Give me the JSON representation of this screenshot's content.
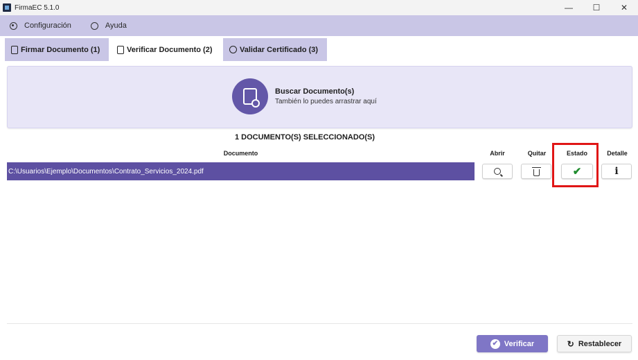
{
  "window": {
    "title": "FirmaEC 5.1.0",
    "controls": {
      "minimize": "—",
      "maximize": "☐",
      "close": "✕"
    }
  },
  "menu": {
    "items": [
      {
        "label": "Configuración",
        "icon": "gear-icon"
      },
      {
        "label": "Ayuda",
        "icon": "globe-icon"
      }
    ]
  },
  "tabs": [
    {
      "label": "Firmar Documento (1)",
      "active": false
    },
    {
      "label": "Verificar Documento (2)",
      "active": true
    },
    {
      "label": "Validar Certificado (3)",
      "active": false
    }
  ],
  "dropzone": {
    "title": "Buscar Documento(s)",
    "subtitle": "También lo puedes arrastrar aquí"
  },
  "selected_count": "1 DOCUMENTO(S) SELECCIONADO(S)",
  "table": {
    "headers": {
      "documento": "Documento",
      "abrir": "Abrir",
      "quitar": "Quitar",
      "estado": "Estado",
      "detalle": "Detalle"
    },
    "rows": [
      {
        "path": "C:\\Usuarios\\Ejemplo\\Documentos\\Contrato_Servicios_2024.pdf",
        "estado_icon": "✔",
        "detalle_icon": "i"
      }
    ]
  },
  "buttons": {
    "verificar": "Verificar",
    "restablecer": "Restablecer",
    "restablecer_icon": "↻",
    "verificar_icon": "✔"
  },
  "colors": {
    "accent": "#5d50a2",
    "menu_bg": "#c9c6e6",
    "highlight": "#e01616",
    "status_ok": "#1f8c2e"
  }
}
